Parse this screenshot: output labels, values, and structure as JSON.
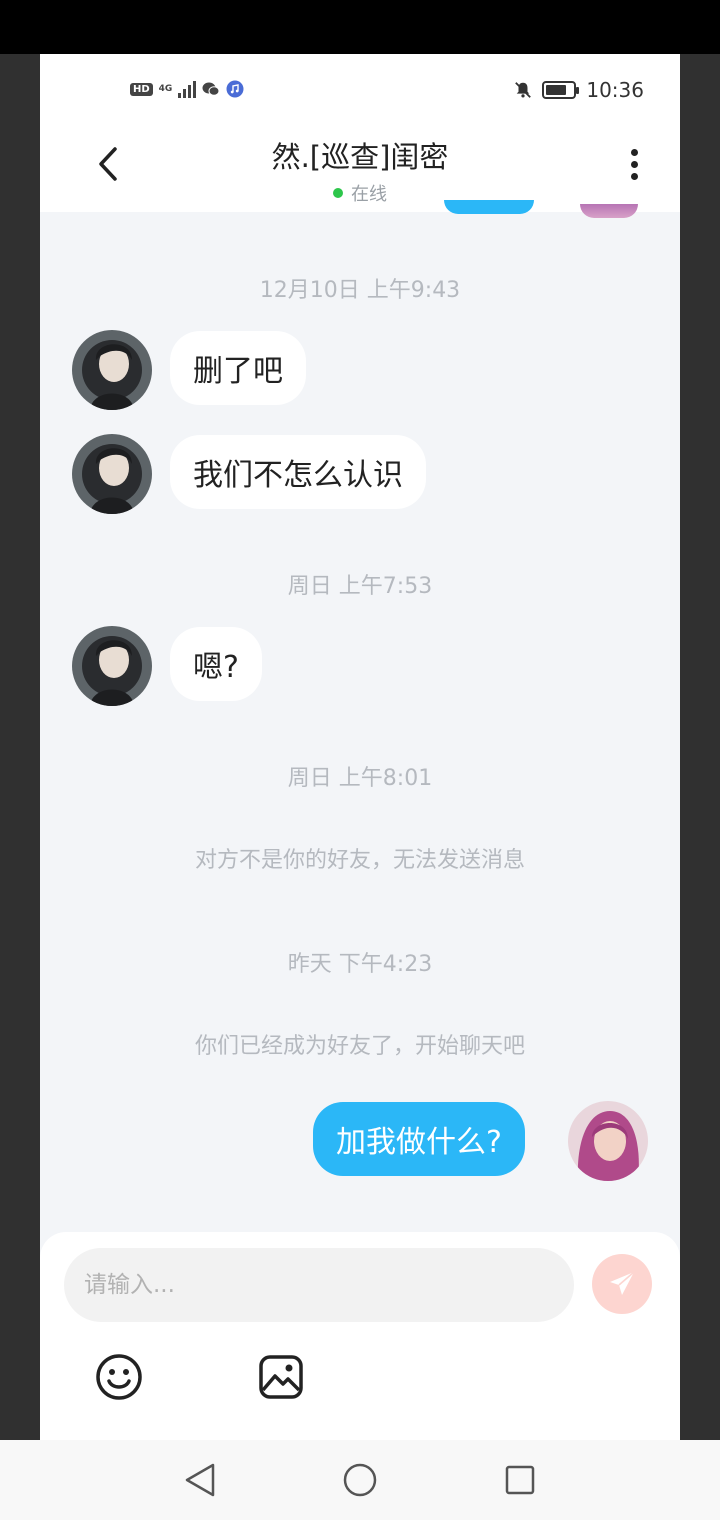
{
  "status_bar": {
    "hd": "HD",
    "network": "4G",
    "time": "10:36",
    "battery_level": 0.7
  },
  "header": {
    "title": "然.[巡查]闺密",
    "status": "在线"
  },
  "messages": [
    {
      "type": "timestamp",
      "text": "12月10日 上午9:43"
    },
    {
      "type": "incoming",
      "text": "删了吧"
    },
    {
      "type": "incoming",
      "text": "我们不怎么认识"
    },
    {
      "type": "timestamp",
      "text": "周日 上午7:53"
    },
    {
      "type": "incoming",
      "text": "嗯?"
    },
    {
      "type": "timestamp",
      "text": "周日 上午8:01"
    },
    {
      "type": "system",
      "text": "对方不是你的好友，无法发送消息"
    },
    {
      "type": "timestamp",
      "text": "昨天 下午4:23"
    },
    {
      "type": "system",
      "text": "你们已经成为好友了，开始聊天吧"
    },
    {
      "type": "outgoing",
      "text": "加我做什么?"
    }
  ],
  "composer": {
    "placeholder": "请输入..."
  },
  "icons": {
    "back": "chevron-left-icon",
    "more": "more-vertical-icon",
    "send": "send-plane-icon",
    "emoji": "emoji-icon",
    "image": "image-icon",
    "nav_back": "triangle-back-icon",
    "nav_home": "circle-home-icon",
    "nav_recent": "square-recent-icon"
  },
  "colors": {
    "outgoing_bubble": "#2bb7f7",
    "online_dot": "#2dc64b",
    "send_button": "#fdd5d0"
  }
}
